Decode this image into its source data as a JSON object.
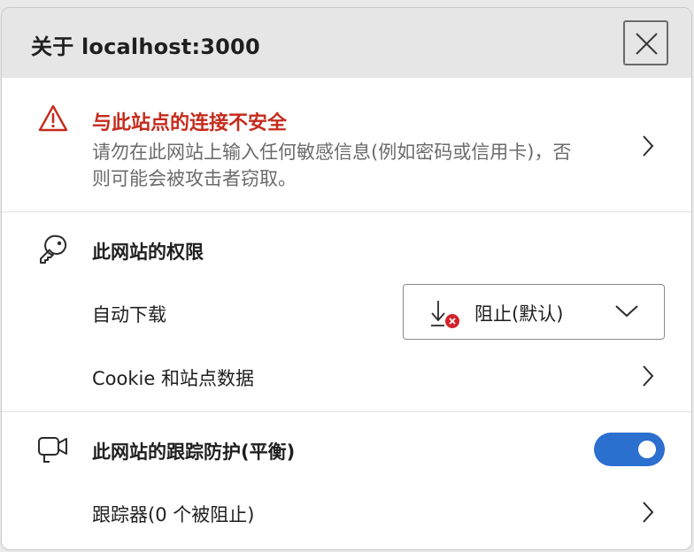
{
  "header": {
    "title": "关于 localhost:3000",
    "close_icon": "close-icon"
  },
  "connection": {
    "icon": "warning-triangle-icon",
    "title": "与此站点的连接不安全",
    "description": "请勿在此网站上输入任何敏感信息(例如密码或信用卡)，否则可能会被攻击者窃取。",
    "color": "#c42b1c"
  },
  "permissions": {
    "icon": "key-icon",
    "title": "此网站的权限",
    "auto_download": {
      "label": "自动下载",
      "selected_value": "阻止(默认)",
      "icon": "download-blocked-icon"
    },
    "cookie_row": {
      "label": "Cookie 和站点数据"
    }
  },
  "tracking": {
    "icon": "camera-icon",
    "title": "此网站的跟踪防护(平衡)",
    "toggle_on": true,
    "toggle_color": "#2b6fcf",
    "trackers_label": "跟踪器(0 个被阻止)"
  }
}
